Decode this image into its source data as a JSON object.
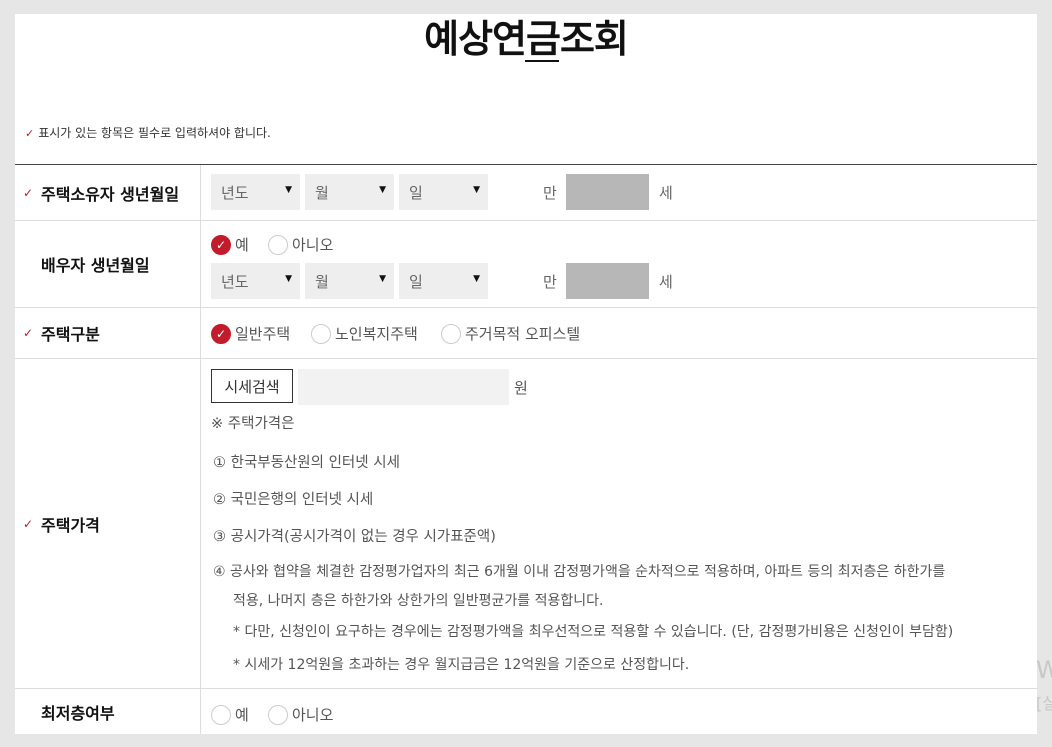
{
  "page": {
    "title": "예상연금조회",
    "required_note": "표시가 있는 항목은 필수로 입력하셔야 합니다."
  },
  "colors": {
    "accent": "#c21c2c",
    "age_box": "#b7b7b7"
  },
  "icons": {
    "required": "check-icon",
    "select": "triangle-down-icon",
    "radio_on": "check-icon"
  },
  "owner_birth": {
    "label": "주택소유자 생년월일",
    "year": "년도",
    "month": "월",
    "day": "일",
    "age_prefix": "만",
    "age_suffix": "세"
  },
  "spouse_birth": {
    "label": "배우자 생년월일",
    "opt_yes": "예",
    "opt_no": "아니오",
    "year": "년도",
    "month": "월",
    "day": "일",
    "age_prefix": "만",
    "age_suffix": "세"
  },
  "house_type": {
    "label": "주택구분",
    "options": [
      "일반주택",
      "노인복지주택",
      "주거목적 오피스텔"
    ]
  },
  "house_price": {
    "label": "주택가격",
    "search_button": "시세검색",
    "unit": "원",
    "note_title": "※ 주택가격은",
    "notes": [
      "① 한국부동산원의 인터넷 시세",
      "② 국민은행의 인터넷 시세",
      "③ 공시가격(공시가격이 없는 경우 시가표준액)",
      "④ 공사와 협약을 체결한 감정평가업자의 최근 6개월 이내 감정평가액을 순차적으로 적용하며, 아파트 등의 최저층은 하한가를",
      "적용, 나머지 층은 하한가와 상한가의 일반평균가를 적용합니다.",
      "* 다만, 신청인이 요구하는 경우에는 감정평가액을 최우선적으로 적용할 수 있습니다. (단, 감정평가비용은 신청인이 부담함)",
      "* 시세가 12억원을 초과하는 경우 월지급금은 12억원을 기준으로 산정합니다."
    ]
  },
  "lowest_floor": {
    "label": "최저층여부",
    "opt_yes": "예",
    "opt_no": "아니오"
  },
  "watermark": {
    "line1": "W",
    "line2": "[실"
  }
}
